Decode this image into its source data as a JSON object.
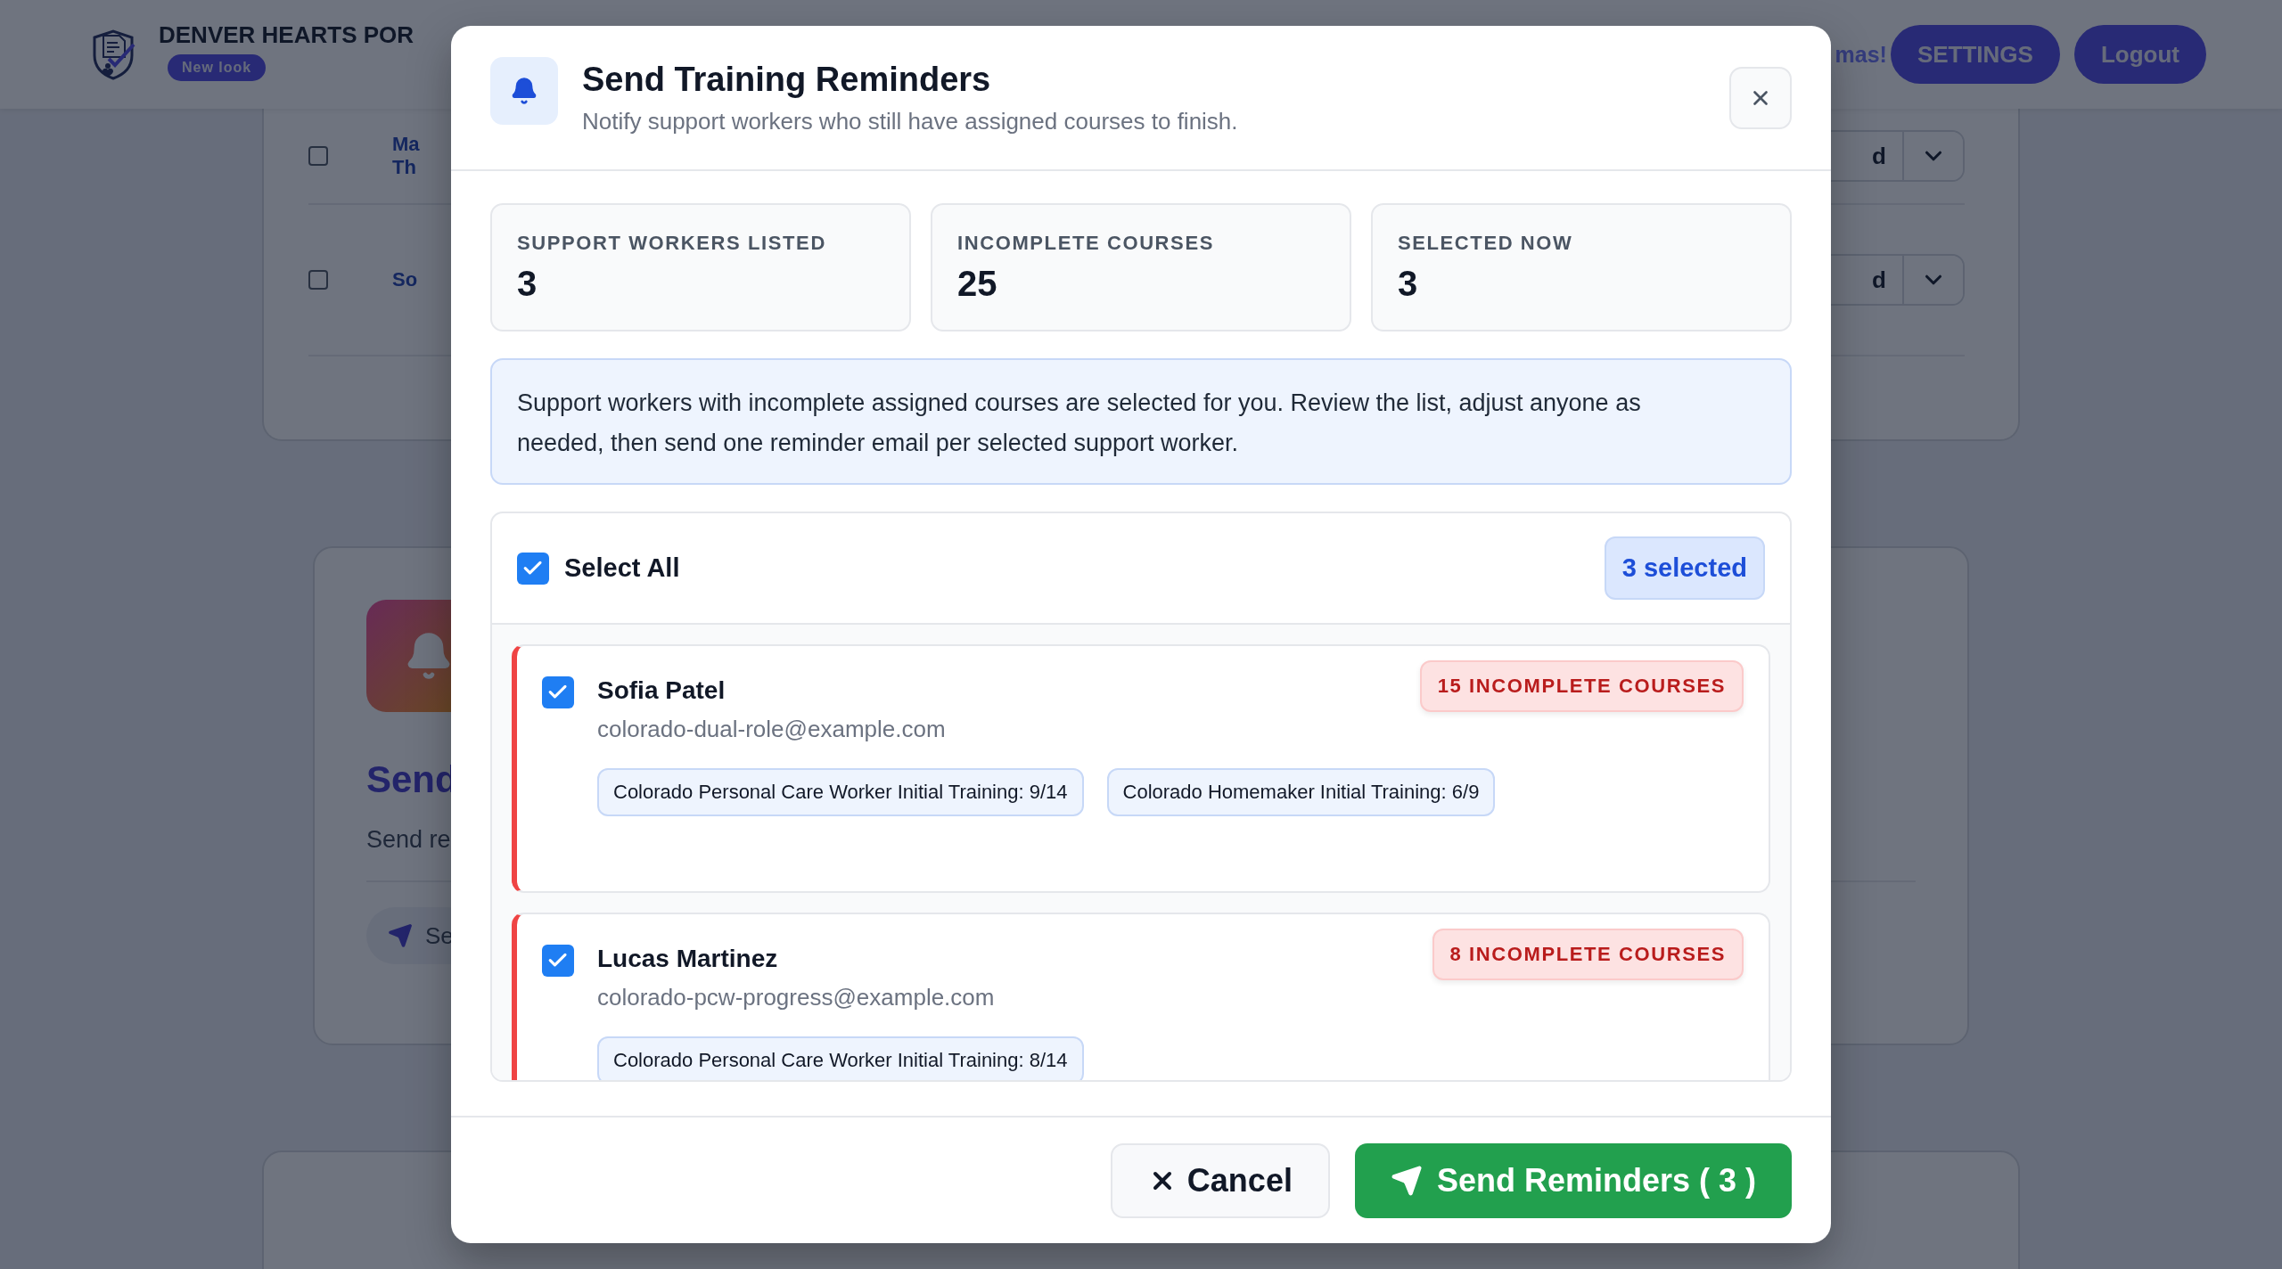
{
  "background_page": {
    "header": {
      "brand": "DENVER HEARTS POR",
      "badge": "New look",
      "greeting": "mas!",
      "buttons": [
        "SETTINGS",
        "Logout"
      ]
    },
    "table_rows": [
      {
        "checked": false,
        "name_lines": [
          "Ma",
          "Th"
        ],
        "action": "d"
      },
      {
        "checked": false,
        "name_lines": [
          "So"
        ],
        "action": "d"
      }
    ],
    "reminder_card": {
      "title": "Send",
      "description": "Send re",
      "button": "Se"
    }
  },
  "dialog": {
    "title": "Send Training Reminders",
    "subtitle": "Notify support workers who still have assigned courses to finish.",
    "stats": [
      {
        "label": "SUPPORT WORKERS LISTED",
        "value": "3"
      },
      {
        "label": "INCOMPLETE COURSES",
        "value": "25"
      },
      {
        "label": "SELECTED NOW",
        "value": "3"
      }
    ],
    "info": "Support workers with incomplete assigned courses are selected for you. Review the list, adjust anyone as needed, then send one reminder email per selected support worker.",
    "select_all": {
      "label": "Select All",
      "checked": true
    },
    "selected_badge": "3 selected",
    "workers": [
      {
        "name": "Sofia Patel",
        "email": "colorado-dual-role@example.com",
        "checked": true,
        "badge": "15 INCOMPLETE COURSES",
        "courses": [
          "Colorado Personal Care Worker Initial Training: 9/14",
          "Colorado Homemaker Initial Training: 6/9"
        ]
      },
      {
        "name": "Lucas Martinez",
        "email": "colorado-pcw-progress@example.com",
        "checked": true,
        "badge": "8 INCOMPLETE COURSES",
        "courses": [
          "Colorado Personal Care Worker Initial Training: 8/14"
        ]
      }
    ],
    "cancel": "Cancel",
    "send": "Send Reminders ( 3 )"
  }
}
